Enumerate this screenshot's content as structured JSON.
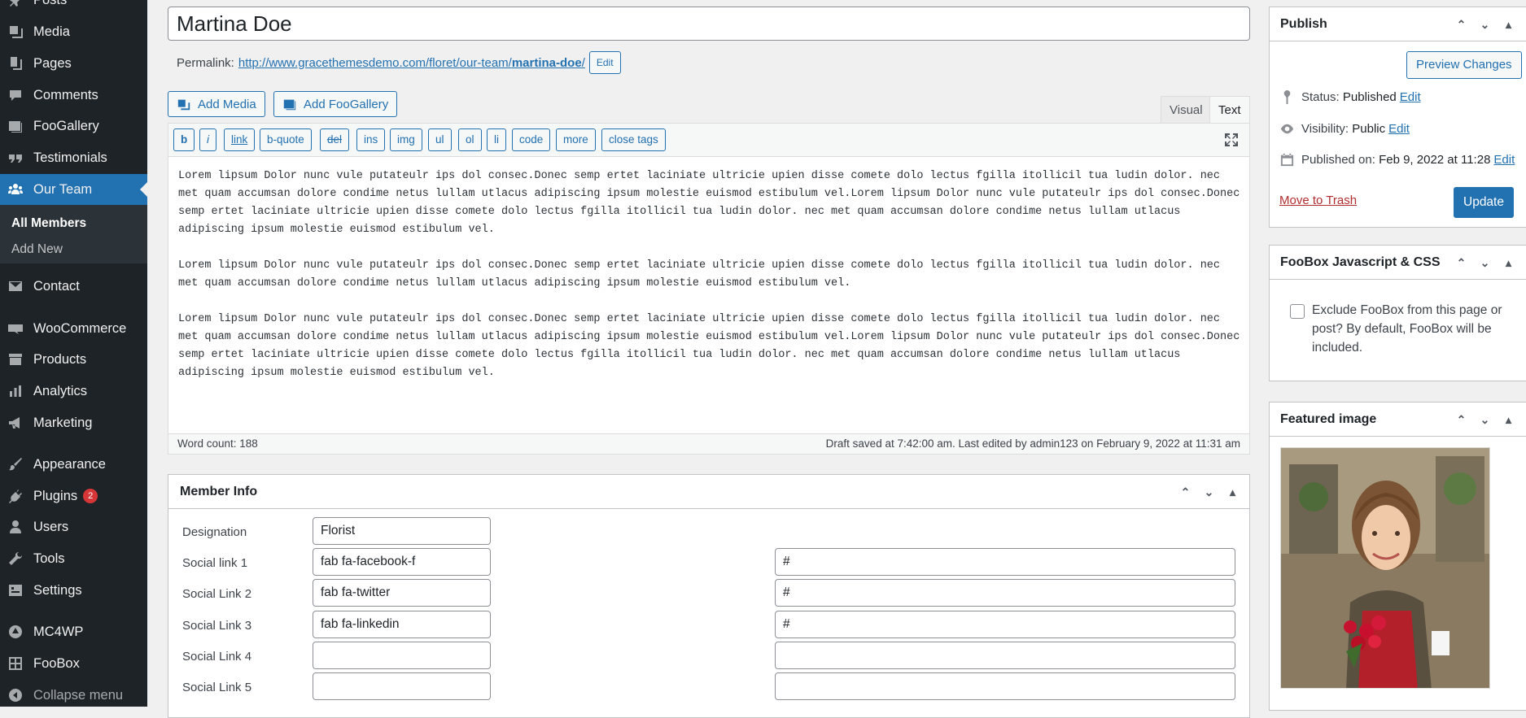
{
  "admin_menu": {
    "items": [
      {
        "label": "Posts",
        "icon": "pushpin-icon"
      },
      {
        "label": "Media",
        "icon": "media-icon"
      },
      {
        "label": "Pages",
        "icon": "pages-icon"
      },
      {
        "label": "Comments",
        "icon": "comments-icon"
      },
      {
        "label": "FooGallery",
        "icon": "gallery-icon"
      },
      {
        "label": "Testimonials",
        "icon": "quote-icon"
      },
      {
        "label": "Our Team",
        "icon": "team-icon",
        "current": true
      },
      {
        "label": "Contact",
        "icon": "mail-icon"
      },
      {
        "label": "WooCommerce",
        "icon": "woo-icon"
      },
      {
        "label": "Products",
        "icon": "archive-icon"
      },
      {
        "label": "Analytics",
        "icon": "chart-icon"
      },
      {
        "label": "Marketing",
        "icon": "megaphone-icon"
      },
      {
        "label": "Appearance",
        "icon": "brush-icon"
      },
      {
        "label": "Plugins",
        "icon": "plugin-icon",
        "badge": "2"
      },
      {
        "label": "Users",
        "icon": "user-icon"
      },
      {
        "label": "Tools",
        "icon": "wrench-icon"
      },
      {
        "label": "Settings",
        "icon": "settings-icon"
      },
      {
        "label": "MC4WP",
        "icon": "mc4wp-icon"
      },
      {
        "label": "FooBox",
        "icon": "foobox-icon"
      }
    ],
    "submenu": {
      "all_members": "All Members",
      "add_new": "Add New"
    },
    "collapse": "Collapse menu"
  },
  "post": {
    "title": "Martina Doe",
    "permalink_label": "Permalink:",
    "permalink_base": "http://www.gracethemesdemo.com/floret/our-team/",
    "permalink_slug": "martina-doe",
    "permalink_trailing": "/",
    "permalink_edit": "Edit"
  },
  "editor": {
    "add_media": "Add Media",
    "add_foogallery": "Add FooGallery",
    "tab_visual": "Visual",
    "tab_text": "Text",
    "quicktags": [
      "b",
      "i",
      "link",
      "b-quote",
      "del",
      "ins",
      "img",
      "ul",
      "ol",
      "li",
      "code",
      "more",
      "close tags"
    ],
    "paragraphs": [
      "Lorem lipsum Dolor nunc vule putateulr ips dol consec.Donec semp ertet laciniate ultricie upien disse comete dolo lectus fgilla itollicil tua ludin dolor. nec met quam accumsan dolore condime netus lullam utlacus adipiscing ipsum molestie euismod estibulum vel.Lorem lipsum Dolor nunc vule putateulr ips dol consec.Donec semp ertet laciniate ultricie upien disse comete dolo lectus fgilla itollicil tua ludin dolor. nec met quam accumsan dolore condime netus lullam utlacus adipiscing ipsum molestie euismod estibulum vel.",
      "Lorem lipsum Dolor nunc vule putateulr ips dol consec.Donec semp ertet laciniate ultricie upien disse comete dolo lectus fgilla itollicil tua ludin dolor. nec met quam accumsan dolore condime netus lullam utlacus adipiscing ipsum molestie euismod estibulum vel.",
      "Lorem lipsum Dolor nunc vule putateulr ips dol consec.Donec semp ertet laciniate ultricie upien disse comete dolo lectus fgilla itollicil tua ludin dolor. nec met quam accumsan dolore condime netus lullam utlacus adipiscing ipsum molestie euismod estibulum vel.Lorem lipsum Dolor nunc vule putateulr ips dol consec.Donec semp ertet laciniate ultricie upien disse comete dolo lectus fgilla itollicil tua ludin dolor. nec met quam accumsan dolore condime netus lullam utlacus adipiscing ipsum molestie euismod estibulum vel."
    ],
    "word_count": "Word count: 188",
    "draft_status": "Draft saved at 7:42:00 am. Last edited by admin123 on February 9, 2022 at 11:31 am"
  },
  "member_info": {
    "title": "Member Info",
    "designation_label": "Designation",
    "designation_value": "Florist",
    "links": [
      {
        "label": "Social link 1",
        "icon_value": "fab fa-facebook-f",
        "url_value": "#"
      },
      {
        "label": "Social Link 2",
        "icon_value": "fab fa-twitter",
        "url_value": "#"
      },
      {
        "label": "Social Link 3",
        "icon_value": "fab fa-linkedin",
        "url_value": "#"
      },
      {
        "label": "Social Link 4",
        "icon_value": "",
        "url_value": ""
      },
      {
        "label": "Social Link 5",
        "icon_value": "",
        "url_value": ""
      }
    ]
  },
  "publish": {
    "title": "Publish",
    "preview": "Preview Changes",
    "status_label": "Status:",
    "status_value": "Published",
    "visibility_label": "Visibility:",
    "visibility_value": "Public",
    "published_label": "Published on:",
    "published_value": "Feb 9, 2022 at 11:28",
    "edit": "Edit",
    "trash": "Move to Trash",
    "update": "Update"
  },
  "foobox": {
    "title": "FooBox Javascript & CSS",
    "checkbox_label": "Exclude FooBox from this page or post? By default, FooBox will be included.",
    "checked": false
  },
  "featured_image": {
    "title": "Featured image"
  },
  "colors": {
    "sidebar_bg": "#1d2327",
    "accent": "#2271b1",
    "danger": "#b32d2e"
  }
}
